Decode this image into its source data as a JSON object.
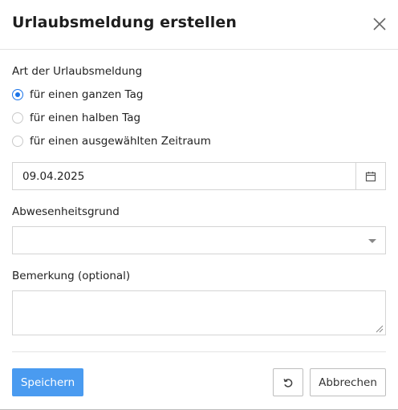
{
  "dialog": {
    "title": "Urlaubsmeldung erstellen",
    "close_icon": "close-icon"
  },
  "type_section": {
    "label": "Art der Urlaubsmeldung",
    "options": [
      {
        "label": "für einen ganzen Tag",
        "checked": true
      },
      {
        "label": "für einen halben Tag",
        "checked": false
      },
      {
        "label": "für einen ausgewählten Zeitraum",
        "checked": false
      }
    ]
  },
  "date": {
    "value": "09.04.2025",
    "icon": "calendar-icon"
  },
  "reason": {
    "label": "Abwesenheitsgrund",
    "value": "",
    "icon": "chevron-down-icon"
  },
  "remark": {
    "label": "Bemerkung (optional)",
    "value": ""
  },
  "footer": {
    "save_label": "Speichern",
    "reset_icon": "reset-icon",
    "cancel_label": "Abbrechen"
  },
  "colors": {
    "primary": "#4a9bf0",
    "radio_accent": "#1a73e8",
    "border": "#d4d4d4"
  }
}
